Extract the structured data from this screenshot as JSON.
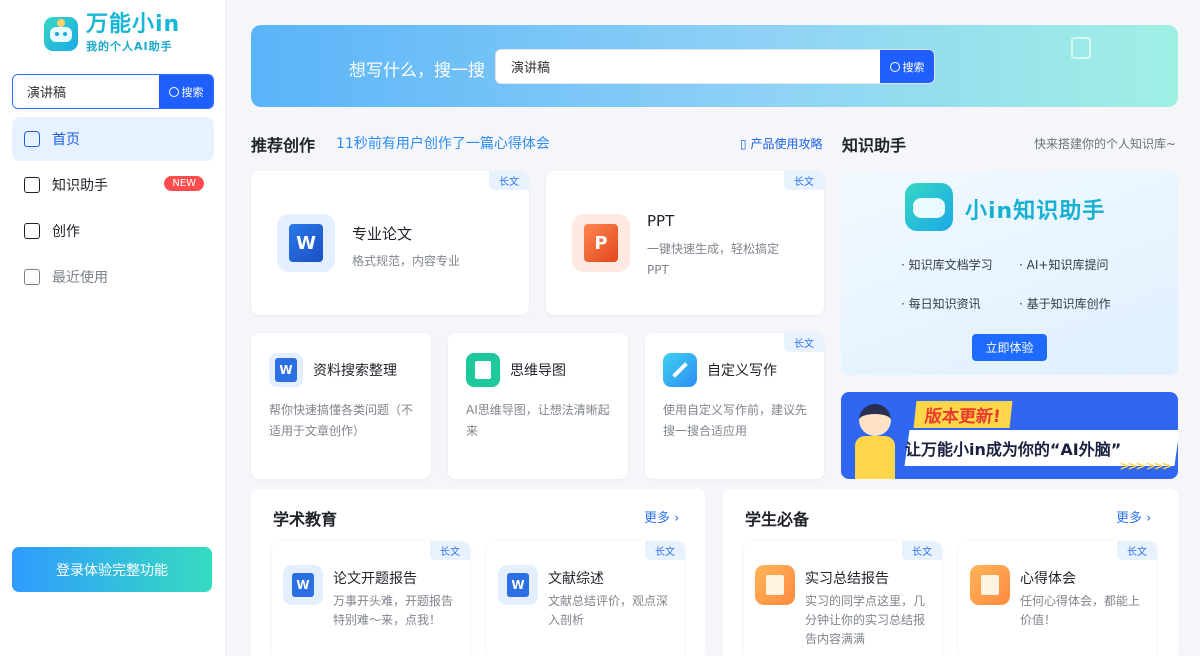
{
  "app": {
    "logo_title": "万能小in",
    "logo_subtitle": "我的个人AI助手"
  },
  "sidebar": {
    "search_value": "演讲稿",
    "search_button": "搜索",
    "items": [
      {
        "label": "首页",
        "icon": "home-icon",
        "active": true
      },
      {
        "label": "知识助手",
        "icon": "knowledge-icon",
        "badge": "NEW"
      },
      {
        "label": "创作",
        "icon": "edit-icon"
      },
      {
        "label": "最近使用",
        "icon": "recent-icon"
      }
    ],
    "login_button": "登录体验完整功能"
  },
  "banner": {
    "label": "想写什么，搜一搜",
    "search_value": "演讲稿",
    "search_button": "搜索"
  },
  "recommend": {
    "title": "推荐创作",
    "subtitle": "11秒前有用户创作了一篇心得体会",
    "guide_link": "产品使用攻略",
    "big_cards": [
      {
        "title": "专业论文",
        "desc": "格式规范，内容专业",
        "tag": "长文",
        "icon": "word-doc-icon"
      },
      {
        "title": "PPT",
        "desc": "一键快速生成，轻松搞定PPT",
        "tag": "长文",
        "icon": "ppt-doc-icon"
      }
    ],
    "small_cards": [
      {
        "title": "资料搜索整理",
        "desc": "帮你快速搞懂各类问题（不适用于文章创作）",
        "icon": "word-doc-icon"
      },
      {
        "title": "思维导图",
        "desc": "AI思维导图，让想法清晰起来",
        "icon": "mindmap-icon"
      },
      {
        "title": "自定义写作",
        "desc": "使用自定义写作前，建议先搜一搜合适应用",
        "tag": "长文",
        "icon": "pen-icon"
      }
    ]
  },
  "knowledge": {
    "title": "知识助手",
    "subtitle": "快来搭建你的个人知识库~",
    "card_title": "小in知识助手",
    "points": [
      "知识库文档学习",
      "AI+知识库提问",
      "每日知识资讯",
      "基于知识库创作"
    ],
    "button": "立即体验"
  },
  "update_banner": {
    "title": "版本更新!",
    "text": "让万能小in成为你的“AI外脑”"
  },
  "academic": {
    "title": "学术教育",
    "more": "更多",
    "cards": [
      {
        "title": "论文开题报告",
        "desc": "万事开头难，开题报告特别难～来，点我！",
        "tag": "长文",
        "icon": "word-doc-icon"
      },
      {
        "title": "文献综述",
        "desc": "文献总结评价，观点深入剖析",
        "tag": "长文",
        "icon": "word-doc-icon"
      }
    ]
  },
  "student": {
    "title": "学生必备",
    "more": "更多",
    "cards": [
      {
        "title": "实习总结报告",
        "desc": "实习的同学点这里，几分钟让你的实习总结报告内容满满",
        "tag": "长文",
        "icon": "scroll-icon"
      },
      {
        "title": "心得体会",
        "desc": "任何心得体会，都能上价值！",
        "tag": "长文",
        "icon": "scroll-icon"
      }
    ]
  },
  "colors": {
    "primary": "#1f5eff",
    "accent_teal": "#36dcc0",
    "badge_red": "#ff4d4f"
  }
}
